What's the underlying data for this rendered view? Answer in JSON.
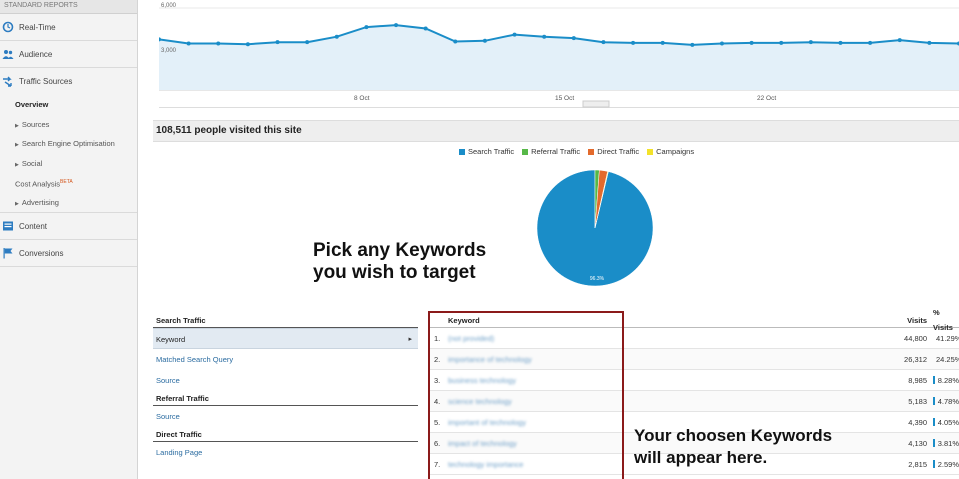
{
  "sidebar": {
    "header": "STANDARD REPORTS",
    "items": [
      {
        "label": "Real-Time"
      },
      {
        "label": "Audience"
      },
      {
        "label": "Traffic Sources"
      }
    ],
    "traffic_sub": [
      {
        "label": "Overview"
      },
      {
        "label": "Sources"
      },
      {
        "label": "Search Engine Optimisation"
      },
      {
        "label": "Social"
      },
      {
        "label": "Cost Analysis",
        "badge": "BETA"
      },
      {
        "label": "Advertising"
      }
    ],
    "bottom_items": [
      {
        "label": "Content"
      },
      {
        "label": "Conversions"
      }
    ]
  },
  "chart": {
    "y_ticks": [
      "6,000",
      "3,000"
    ],
    "x_ticks": [
      "8 Oct",
      "15 Oct",
      "22 Oct"
    ],
    "points": [
      3700,
      3400,
      3400,
      3350,
      3500,
      3500,
      3900,
      4600,
      4750,
      4500,
      3550,
      3600,
      4050,
      3900,
      3800,
      3500,
      3450,
      3450,
      3300,
      3400,
      3450,
      3450,
      3500,
      3450,
      3450,
      3650,
      3450,
      3400
    ],
    "ymax": 6000,
    "color": "#1a8dc8",
    "fill": "#e3f0f9"
  },
  "summary": {
    "text": "108,511 people visited this site"
  },
  "pie": {
    "legend": [
      {
        "label": "Search Traffic",
        "color": "#1a8dc8"
      },
      {
        "label": "Referral Traffic",
        "color": "#57b848"
      },
      {
        "label": "Direct Traffic",
        "color": "#e36a2c"
      },
      {
        "label": "Campaigns",
        "color": "#f3e22a"
      }
    ],
    "values": [
      96.3,
      1.2,
      2.3,
      0.2
    ],
    "label": "96.3%"
  },
  "annotations": {
    "pick_line1": "Pick any Keywords",
    "pick_line2": "you wish to target",
    "appear_line1": "Your choosen Keywords",
    "appear_line2": "will appear here."
  },
  "traffic_nav": {
    "search_header": "Search Traffic",
    "keyword": "Keyword",
    "matched": "Matched Search Query",
    "source1": "Source",
    "referral_header": "Referral Traffic",
    "source2": "Source",
    "direct_header": "Direct Traffic",
    "landing": "Landing Page"
  },
  "keyword_table": {
    "col_keyword": "Keyword",
    "col_visits": "Visits",
    "col_pct": "% Visits",
    "rows": [
      {
        "num": "1.",
        "keyword": "(not provided)",
        "visits": "44,800",
        "pct": "41.29%",
        "share": 41.29
      },
      {
        "num": "2.",
        "keyword": "importance of technology",
        "visits": "26,312",
        "pct": "24.25%",
        "share": 24.25
      },
      {
        "num": "3.",
        "keyword": "business technology",
        "visits": "8,985",
        "pct": "8.28%",
        "share": 8.28
      },
      {
        "num": "4.",
        "keyword": "science technology",
        "visits": "5,183",
        "pct": "4.78%",
        "share": 4.78
      },
      {
        "num": "5.",
        "keyword": "important of technology",
        "visits": "4,390",
        "pct": "4.05%",
        "share": 4.05
      },
      {
        "num": "6.",
        "keyword": "impact of technology",
        "visits": "4,130",
        "pct": "3.81%",
        "share": 3.81
      },
      {
        "num": "7.",
        "keyword": "technology importance",
        "visits": "2,815",
        "pct": "2.59%",
        "share": 2.59
      }
    ]
  }
}
